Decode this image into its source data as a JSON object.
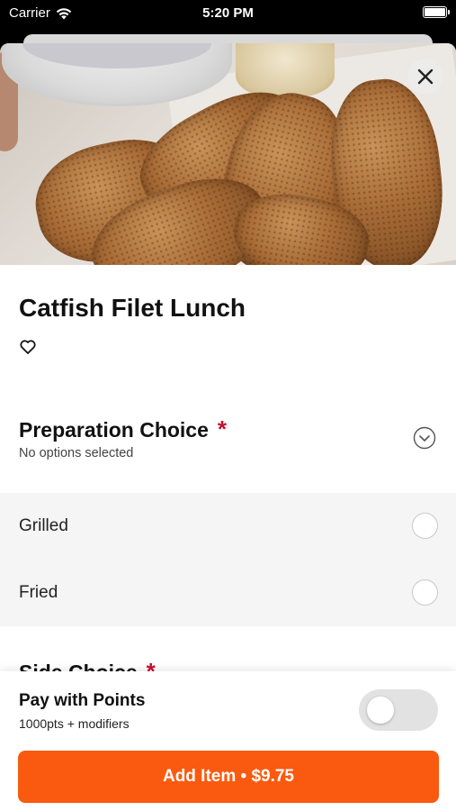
{
  "status_bar": {
    "carrier": "Carrier",
    "time": "5:20 PM",
    "wifi_icon": "wifi-icon",
    "battery_icon": "battery-icon"
  },
  "item": {
    "name": "Catfish Filet Lunch",
    "favorite_icon": "heart-outline-icon",
    "close_icon": "close-icon"
  },
  "preparation": {
    "title": "Preparation Choice",
    "required_marker": "*",
    "subtitle": "No options selected",
    "options": [
      {
        "label": "Grilled",
        "selected": false
      },
      {
        "label": "Fried",
        "selected": false
      }
    ]
  },
  "side": {
    "title": "Side Choice",
    "required_marker": "*"
  },
  "points": {
    "title": "Pay with Points",
    "subtitle": "1000pts + modifiers",
    "enabled": false
  },
  "add_button": {
    "label": "Add Item • $9.75"
  },
  "colors": {
    "accent": "#fa5a0f",
    "required": "#c8102e"
  }
}
